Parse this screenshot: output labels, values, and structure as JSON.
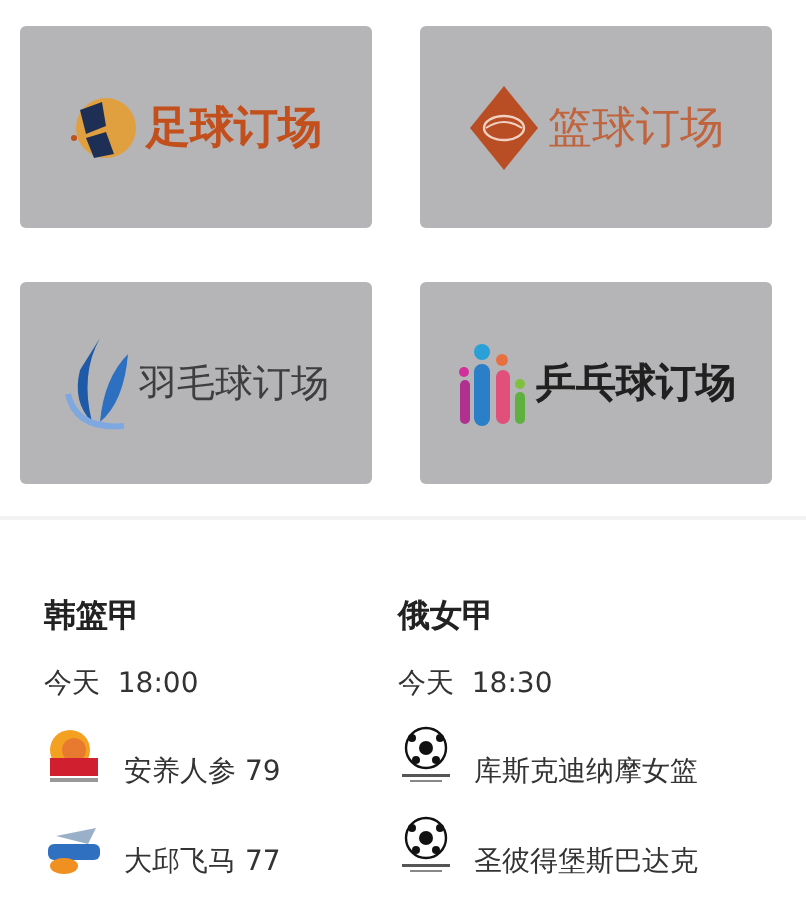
{
  "venues": [
    {
      "label": "足球订场",
      "kind": "soccer"
    },
    {
      "label": "篮球订场",
      "kind": "basketball"
    },
    {
      "label": "羽毛球订场",
      "kind": "badminton"
    },
    {
      "label": "乒乓球订场",
      "kind": "pingpong"
    }
  ],
  "matches": [
    {
      "league": "韩篮甲",
      "day": "今天",
      "time": "18:00",
      "teams": [
        {
          "name": "安养人参",
          "score": "79",
          "kind": "sun"
        },
        {
          "name": "大邱飞马",
          "score": "77",
          "kind": "wing"
        }
      ]
    },
    {
      "league": "俄女甲",
      "day": "今天",
      "time": "18:30",
      "teams": [
        {
          "name": "库斯克迪纳摩女篮",
          "kind": "ball"
        },
        {
          "name": "圣彼得堡斯巴达克",
          "kind": "ball"
        }
      ]
    }
  ]
}
